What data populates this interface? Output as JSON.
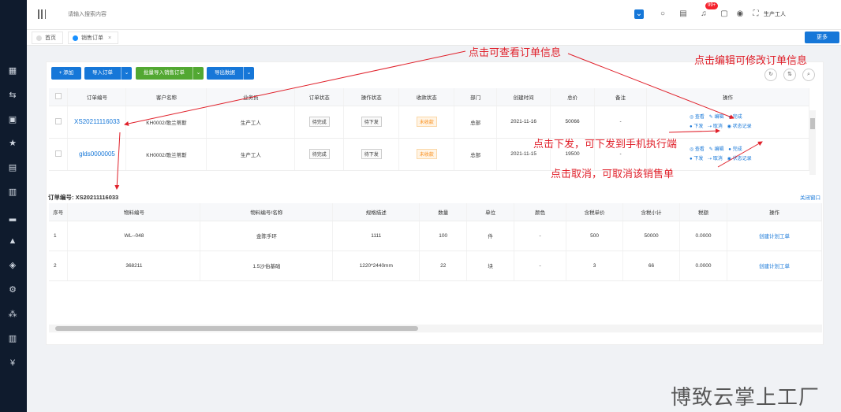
{
  "topbar": {
    "search_placeholder": "请输入搜索内容",
    "notification_count": "99+",
    "username": "生产工人"
  },
  "tabs": [
    {
      "label": "首页"
    },
    {
      "label": "销售订单"
    }
  ],
  "tab_close": "×",
  "more_button": "更多",
  "toolbar": {
    "add": "+ 添加",
    "import": "导入订单",
    "batch_import": "批量导入销售订单",
    "export": "导出数据"
  },
  "orders": {
    "columns": [
      "订单编号",
      "客户名称",
      "业务员",
      "订单状态",
      "操作状态",
      "收款状态",
      "部门",
      "创建时间",
      "总价",
      "备注",
      "操作"
    ],
    "rows": [
      {
        "no": "XS20211116033",
        "customer": "KH0002/歌兰蒂斯",
        "salesman": "生产工人",
        "order_status": "待完成",
        "op_status": "待下发",
        "pay_status": "未收款",
        "dept": "总部",
        "created": "2021-11-16",
        "total": "50066",
        "remark": "-"
      },
      {
        "no": "glds0000005",
        "customer": "KH0002/歌兰蒂斯",
        "salesman": "生产工人",
        "order_status": "待完成",
        "op_status": "待下发",
        "pay_status": "未收款",
        "dept": "总部",
        "created": "2021-11-15",
        "total": "19500",
        "remark": "-"
      }
    ],
    "actions_row1": [
      "查看",
      "编辑",
      "完成"
    ],
    "actions_row2": [
      "下发",
      "取消",
      "状态记录"
    ]
  },
  "detail": {
    "label": "订单编号:  XS20211116033",
    "close": "关闭窗口",
    "columns": [
      "序号",
      "物料编号",
      "物料编号/名称",
      "规格描述",
      "数量",
      "单位",
      "颜色",
      "含税单价",
      "含税小计",
      "税额",
      "操作"
    ],
    "rows": [
      {
        "idx": "1",
        "code": "WL--048",
        "name": "金陈手环",
        "spec": "1111",
        "qty": "100",
        "unit": "件",
        "color": "-",
        "price": "500",
        "subtotal": "50000",
        "tax": "0.0000",
        "action": "创建计划工单"
      },
      {
        "idx": "2",
        "code": "368211",
        "name": "1.5沙伯基础",
        "spec": "1220*2440mm",
        "qty": "22",
        "unit": "块",
        "color": "-",
        "price": "3",
        "subtotal": "66",
        "tax": "0.0000",
        "action": "创建计划工单"
      }
    ]
  },
  "annotations": {
    "view": "点击可查看订单信息",
    "edit": "点击编辑可修改订单信息",
    "dispatch": "点击下发，可下发到手机执行端",
    "cancel": "点击取消，可取消该销售单"
  },
  "watermark": "博致云掌上工厂",
  "colors": {
    "primary": "#1677d8",
    "green": "#52a832",
    "sidebar": "#0f1b2d",
    "annotation": "#e0202a"
  }
}
